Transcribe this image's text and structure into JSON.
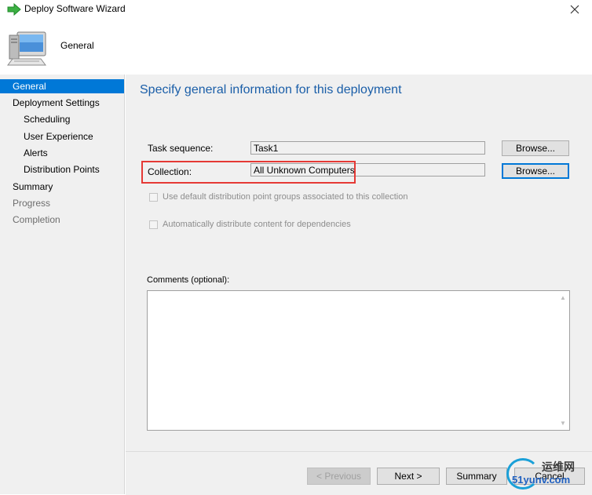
{
  "window": {
    "title": "Deploy Software Wizard"
  },
  "header": {
    "title": "General"
  },
  "nav": {
    "items": [
      {
        "label": "General",
        "state": "selected"
      },
      {
        "label": "Deployment Settings",
        "state": "normal"
      },
      {
        "label": "Scheduling",
        "state": "normal"
      },
      {
        "label": "User Experience",
        "state": "normal"
      },
      {
        "label": "Alerts",
        "state": "normal"
      },
      {
        "label": "Distribution Points",
        "state": "normal"
      },
      {
        "label": "Summary",
        "state": "normal"
      },
      {
        "label": "Progress",
        "state": "disabled"
      },
      {
        "label": "Completion",
        "state": "disabled"
      }
    ]
  },
  "main": {
    "heading": "Specify general information for this deployment",
    "task_sequence": {
      "label": "Task sequence:",
      "value": "Task1",
      "browse": "Browse..."
    },
    "collection": {
      "label": "Collection:",
      "value": "All Unknown Computers",
      "browse": "Browse..."
    },
    "checkbox_default_dp": "Use default distribution point groups associated to this collection",
    "checkbox_auto_distribute": "Automatically distribute content for dependencies",
    "comments_label": "Comments (optional):",
    "comments_value": ""
  },
  "footer": {
    "previous": "< Previous",
    "next": "Next >",
    "summary": "Summary",
    "cancel": "Cancel"
  },
  "watermark": {
    "line1": "运维网",
    "line2": "51yunv.com"
  },
  "colors": {
    "accent": "#0078d7",
    "heading": "#1a5ea8",
    "highlight": "#e53935"
  }
}
